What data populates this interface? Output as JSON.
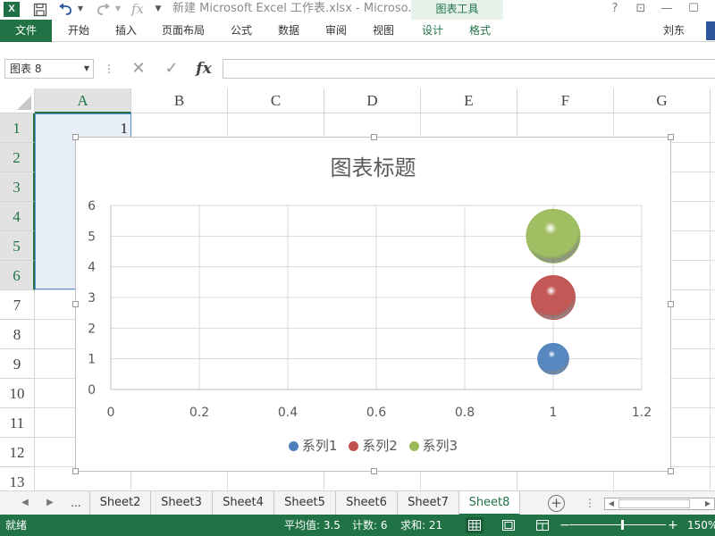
{
  "app": {
    "title": "新建 Microsoft Excel 工作表.xlsx - Microso...",
    "logo": "X",
    "context_tab_group": "图表工具",
    "quick_access": {
      "save_icon": "save-icon",
      "undo_icon": "undo-icon",
      "redo_icon": "redo-icon",
      "fx": "fx"
    },
    "window_buttons": {
      "help": "?",
      "restore": "⊡",
      "minimize": "—",
      "maximize": "☐"
    }
  },
  "ribbon": {
    "file": "文件",
    "tabs": [
      "开始",
      "插入",
      "页面布局",
      "公式",
      "数据",
      "审阅",
      "视图",
      "设计",
      "格式"
    ],
    "user": "刘东"
  },
  "formula_bar": {
    "name_box": "图表 8",
    "value": "",
    "cancel_icon": "✕",
    "enter_icon": "✓",
    "fx_label": "fx"
  },
  "sheet": {
    "columns": [
      "A",
      "B",
      "C",
      "D",
      "E",
      "F",
      "G"
    ],
    "rows": [
      "1",
      "2",
      "3",
      "4",
      "5",
      "6",
      "7",
      "8",
      "9",
      "10",
      "11",
      "12",
      "13"
    ],
    "selected_columns": [
      "A"
    ],
    "selected_rows": [
      "1",
      "2",
      "3",
      "4",
      "5",
      "6"
    ],
    "cells": {
      "A1": "1"
    }
  },
  "chart_data": {
    "type": "bubble",
    "title": "图表标题",
    "xlabel": "",
    "ylabel": "",
    "xlim": [
      0,
      1.2
    ],
    "ylim": [
      0,
      6
    ],
    "xticks": [
      "0",
      "0.2",
      "0.4",
      "0.6",
      "0.8",
      "1",
      "1.2"
    ],
    "yticks": [
      "0",
      "1",
      "2",
      "3",
      "4",
      "5",
      "6"
    ],
    "grid": true,
    "legend_position": "bottom",
    "series": [
      {
        "name": "系列1",
        "x": [
          1
        ],
        "y": [
          1
        ],
        "size": [
          2
        ],
        "color": "#4f81bd"
      },
      {
        "name": "系列2",
        "x": [
          1
        ],
        "y": [
          3
        ],
        "size": [
          4
        ],
        "color": "#c0504d"
      },
      {
        "name": "系列3",
        "x": [
          1
        ],
        "y": [
          5
        ],
        "size": [
          6
        ],
        "color": "#9bbb59"
      }
    ]
  },
  "sheet_tabs": {
    "ellipsis": "...",
    "tabs": [
      "Sheet2",
      "Sheet3",
      "Sheet4",
      "Sheet5",
      "Sheet6",
      "Sheet7",
      "Sheet8"
    ],
    "active": "Sheet8",
    "add_label": "+"
  },
  "status_bar": {
    "ready": "就绪",
    "average": "平均值: 3.5",
    "count": "计数: 6",
    "sum": "求和: 21",
    "zoom": "150%",
    "zoom_fraction": 0.55
  }
}
